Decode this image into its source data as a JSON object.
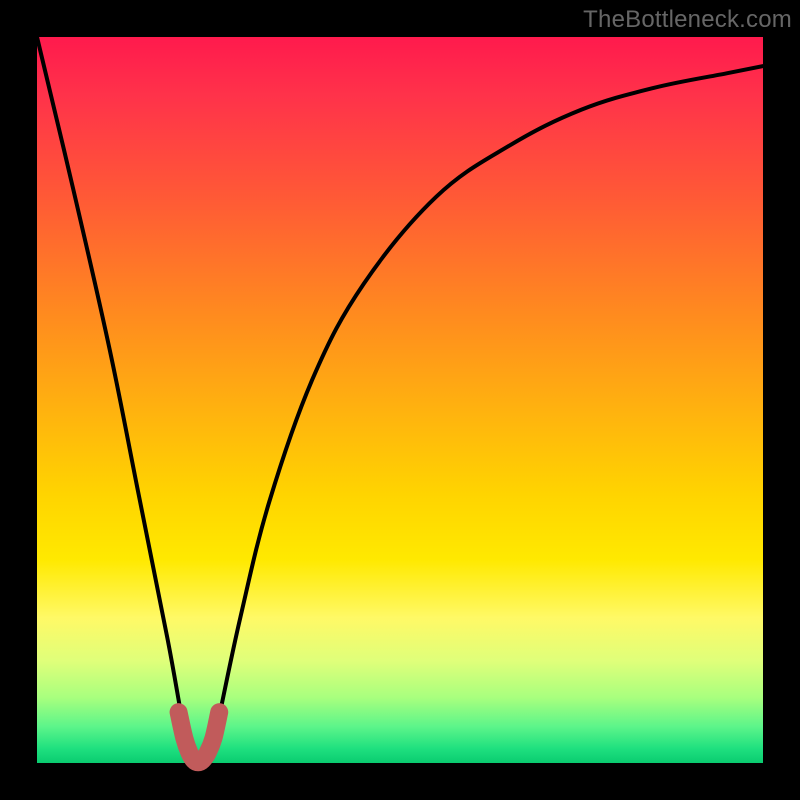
{
  "attribution": "TheBottleneck.com",
  "chart_data": {
    "type": "line",
    "title": "",
    "xlabel": "",
    "ylabel": "",
    "xlim": [
      0,
      100
    ],
    "ylim": [
      0,
      100
    ],
    "series": [
      {
        "name": "bottleneck-curve",
        "x": [
          0,
          5,
          10,
          14,
          18,
          20,
          21,
          22,
          23,
          24,
          25,
          28,
          32,
          38,
          45,
          55,
          65,
          75,
          85,
          95,
          100
        ],
        "values": [
          100,
          79,
          57,
          37,
          17,
          6,
          2,
          0,
          0,
          2,
          6,
          20,
          36,
          53,
          66,
          78,
          85,
          90,
          93,
          95,
          96
        ]
      },
      {
        "name": "trough-highlight",
        "x": [
          19.5,
          20.3,
          21.0,
          21.6,
          22.2,
          22.8,
          23.5,
          24.3,
          25.1
        ],
        "values": [
          7.0,
          3.4,
          1.4,
          0.4,
          0.1,
          0.4,
          1.4,
          3.4,
          7.0
        ]
      }
    ],
    "colors": {
      "curve": "#000000",
      "trough": "#c15b5b"
    }
  }
}
